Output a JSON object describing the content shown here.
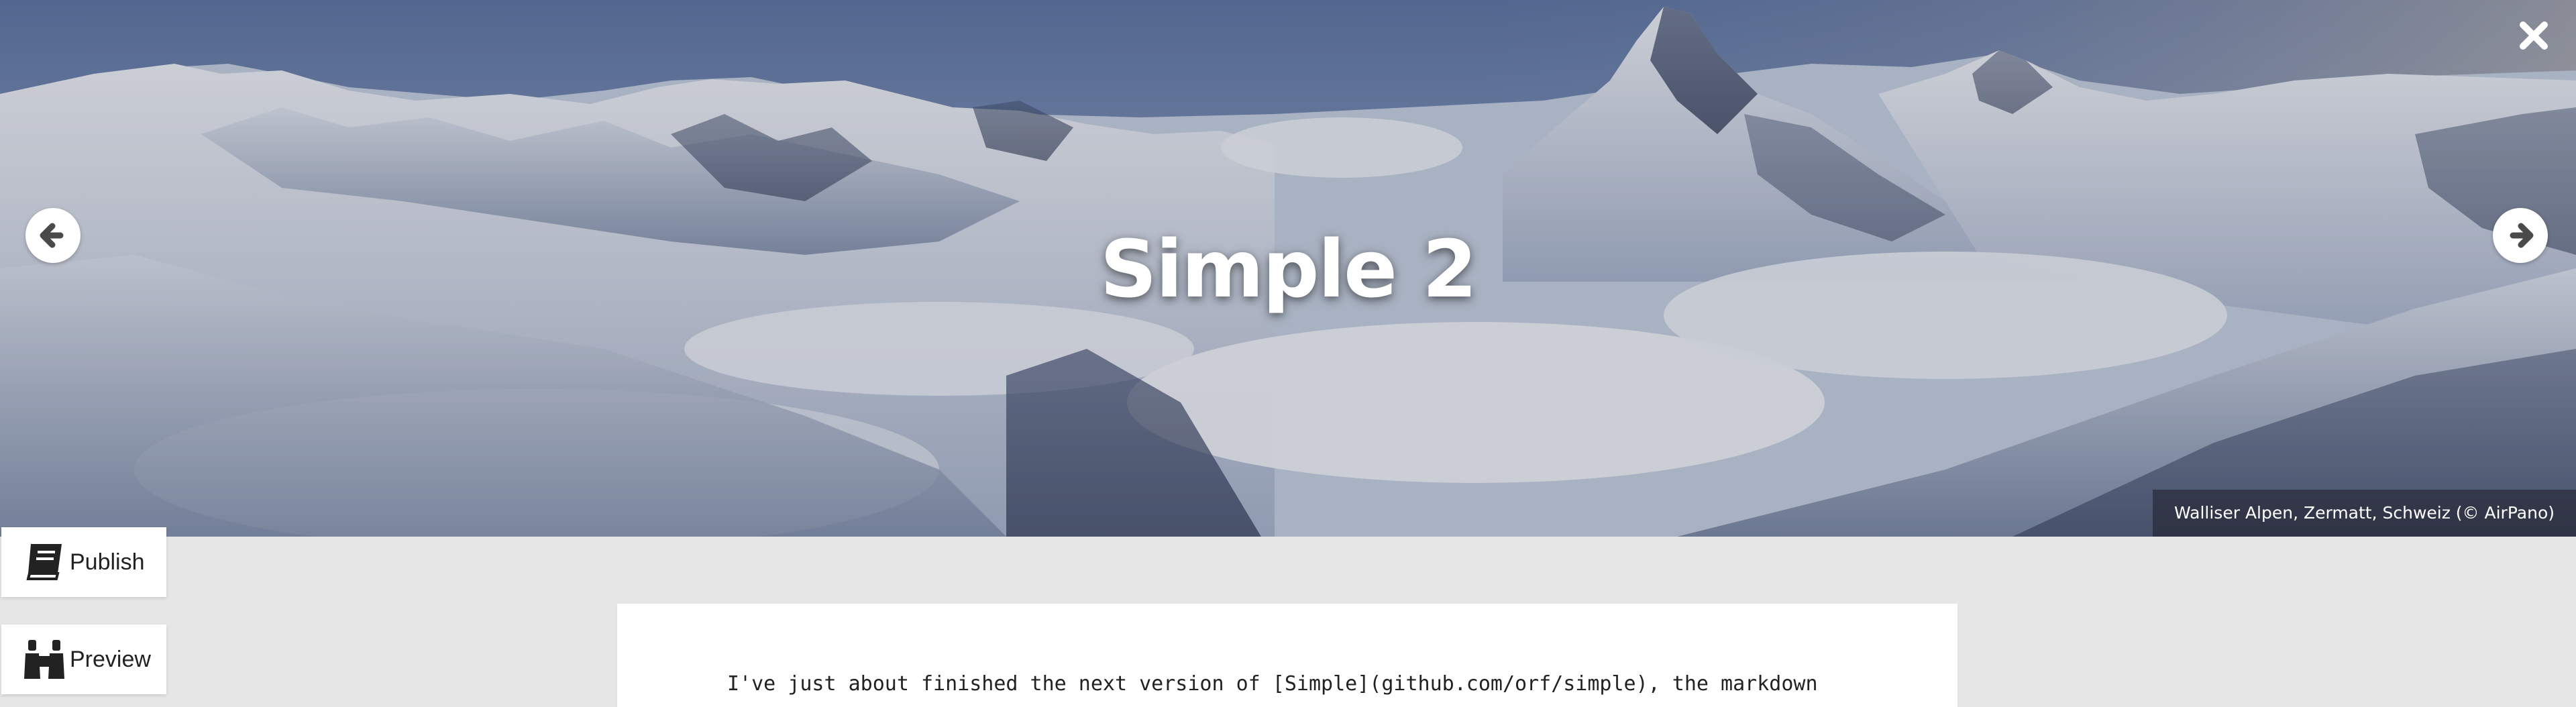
{
  "hero": {
    "title": "Simple 2",
    "caption": "Walliser Alpen, Zermatt, Schweiz (© AirPano)",
    "prev_icon": "arrow-left-circle-icon",
    "next_icon": "arrow-right-circle-icon",
    "close_icon": "close-x-icon"
  },
  "sidebar": {
    "publish": {
      "label": "Publish",
      "icon": "book-icon"
    },
    "preview": {
      "label": "Preview",
      "icon": "binoculars-icon"
    }
  },
  "editor": {
    "line1": "I've just about finished the next version of [Simple](github.com/orf/simple), the markdown"
  }
}
